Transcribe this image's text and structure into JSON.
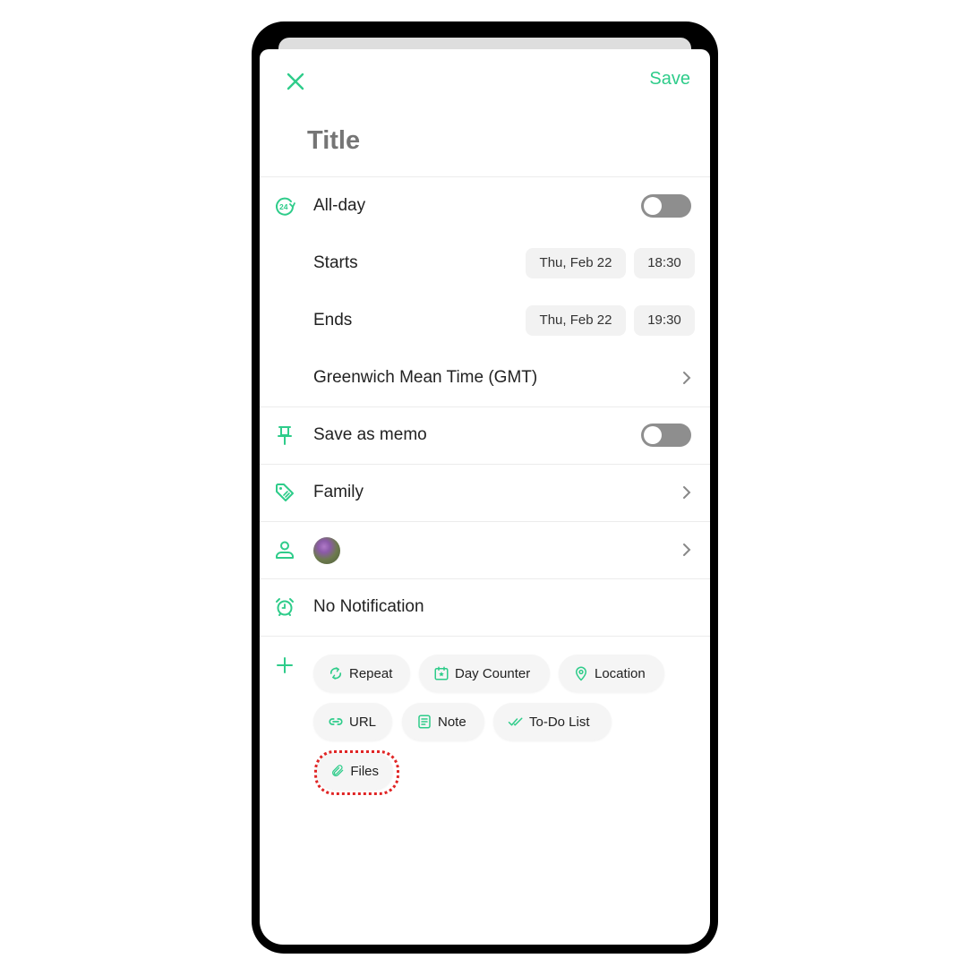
{
  "header": {
    "close_icon": "close-icon",
    "save_label": "Save",
    "title_placeholder": "Title"
  },
  "all_day": {
    "label": "All-day",
    "icon": "24-hour-icon",
    "enabled": false
  },
  "starts": {
    "label": "Starts",
    "date": "Thu, Feb 22",
    "time": "18:30"
  },
  "ends": {
    "label": "Ends",
    "date": "Thu, Feb 22",
    "time": "19:30"
  },
  "timezone": {
    "label": "Greenwich Mean Time (GMT)"
  },
  "memo": {
    "label": "Save as memo",
    "icon": "pin-icon",
    "enabled": false
  },
  "category": {
    "label": "Family",
    "icon": "tag-icon"
  },
  "participants": {
    "icon": "person-icon",
    "avatar": "flower-avatar"
  },
  "notification": {
    "label": "No Notification",
    "icon": "alarm-icon"
  },
  "add_options": {
    "icon": "plus-icon",
    "chips": [
      {
        "label": "Repeat",
        "icon": "repeat-icon"
      },
      {
        "label": "Day Counter",
        "icon": "calendar-star-icon"
      },
      {
        "label": "Location",
        "icon": "location-pin-icon"
      },
      {
        "label": "URL",
        "icon": "link-icon"
      },
      {
        "label": "Note",
        "icon": "note-icon"
      },
      {
        "label": "To-Do List",
        "icon": "double-check-icon"
      },
      {
        "label": "Files",
        "icon": "paperclip-icon",
        "highlighted": true
      }
    ]
  },
  "colors": {
    "accent": "#2ecc8a",
    "highlight": "#e02424",
    "toggle_off": "#8e8e8e"
  }
}
